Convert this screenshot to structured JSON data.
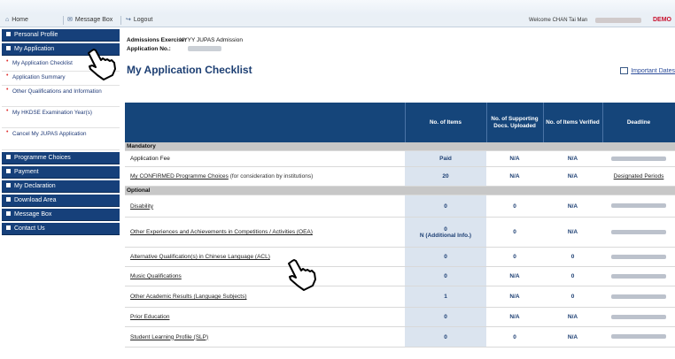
{
  "topnav": {
    "home_label": "Home",
    "messagebox_label": "Message Box",
    "logout_label": "Logout",
    "welcome_text": "Welcome CHAN Tai Man",
    "demo_label": "DEMO"
  },
  "sidebar": {
    "personal_profile": "Personal Profile",
    "my_application": "My Application",
    "subitems": [
      "My Application Checklist",
      "Application Summary",
      "Other Qualifications and Information",
      "My HKDSE Examination Year(s)",
      "Cancel My JUPAS Application"
    ],
    "programme_choices": "Programme Choices",
    "payment": "Payment",
    "my_declaration": "My Declaration",
    "download_area": "Download Area",
    "message_box": "Message Box",
    "contact_us": "Contact Us"
  },
  "meta": {
    "admission_label": "Admissions Exercise:",
    "admission_value": "YYYY JUPAS Admission",
    "appno_label": "Application No.:"
  },
  "page_title": "My Application Checklist",
  "important_dates": "Important Dates",
  "table": {
    "headers": [
      "",
      "No. of Items",
      "No. of Supporting Docs. Uploaded",
      "No. of Items Verified",
      "Deadline"
    ],
    "mandatory_label": "Mandatory",
    "optional_label": "Optional",
    "rows": [
      {
        "label": "Application Fee",
        "note": "",
        "items": "Paid",
        "items2": "",
        "docs": "N/A",
        "verified": "N/A",
        "deadline": ""
      },
      {
        "label": "My CONFIRMED Programme Choices",
        "note": "(for consideration by institutions)",
        "items": "20",
        "items2": "",
        "docs": "N/A",
        "verified": "N/A",
        "deadline": "Designated Periods"
      },
      {
        "label": "Disability",
        "note": "",
        "items": "0",
        "items2": "",
        "docs": "0",
        "verified": "N/A",
        "deadline": ""
      },
      {
        "label": "Other Experiences and Achievements in Competitions / Activities (OEA)",
        "note": "",
        "items": "0",
        "items2": "N (Additional Info.)",
        "docs": "0",
        "verified": "N/A",
        "deadline": ""
      },
      {
        "label": "Alternative Qualification(s) in Chinese Language (ACL)",
        "note": "",
        "items": "0",
        "items2": "",
        "docs": "0",
        "verified": "0",
        "deadline": ""
      },
      {
        "label": "Music Qualifications",
        "note": "",
        "items": "0",
        "items2": "",
        "docs": "N/A",
        "verified": "0",
        "deadline": ""
      },
      {
        "label": "Other Academic Results (Language Subjects)",
        "note": "",
        "items": "1",
        "items2": "",
        "docs": "N/A",
        "verified": "0",
        "deadline": ""
      },
      {
        "label": "Prior Education",
        "note": "",
        "items": "0",
        "items2": "",
        "docs": "N/A",
        "verified": "N/A",
        "deadline": ""
      },
      {
        "label": "Student Learning Profile (SLP)",
        "note": "",
        "items": "0",
        "items2": "",
        "docs": "0",
        "verified": "N/A",
        "deadline": ""
      }
    ]
  },
  "colors": {
    "nav_blue": "#16407a",
    "header_blue": "#15457a",
    "demo_red": "#c8102e",
    "title_blue": "#1d3f73"
  }
}
